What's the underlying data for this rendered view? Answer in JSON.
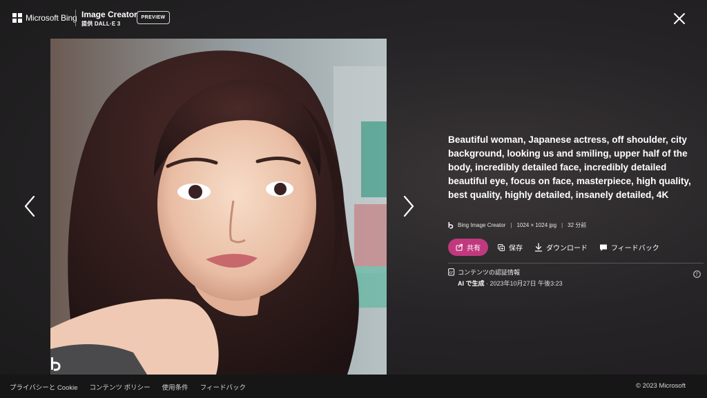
{
  "header": {
    "brand_label": "Microsoft Bing",
    "product_title": "Image Creator",
    "product_subtitle": "提供 DALL·E 3",
    "preview_badge": "PREVIEW",
    "icons": {
      "logo": "microsoft-logo-icon",
      "close": "close-icon"
    }
  },
  "image": {
    "alt": "Beautiful woman, Japanese actress, off shoulder, city background, looking us and smiling, upper half of the body, incredibly detailed face, incredibly detailed beautiful eye, focus on face, masterpiece, high quality, best quality, highly detailed, insanely detailed, 4K",
    "watermark_icon": "bing-watermark-icon"
  },
  "navigation": {
    "prev_icon": "chevron-left-icon",
    "next_icon": "chevron-right-icon"
  },
  "details": {
    "prompt": "Beautiful woman, Japanese actress, off shoulder, city background, looking us and smiling, upper half of the body, incredibly detailed face, incredibly detailed beautiful eye, focus on face, masterpiece, high quality, best quality, highly detailed, insanely detailed, 4K",
    "meta": {
      "source": "Bing Image Creator",
      "size": "1024 × 1024 jpg",
      "age": "32 分前"
    },
    "actions": {
      "share": "共有",
      "save": "保存",
      "download": "ダウンロード",
      "feedback": "フィードバック"
    },
    "credentials": {
      "title": "コンテンツの認証情報",
      "generated_label": "AI で生成",
      "generated_date": "· 2023年10月27日 午後3:23"
    }
  },
  "footer": {
    "links": [
      "プライバシーと Cookie",
      "コンテンツ ポリシー",
      "使用条件",
      "フィードバック"
    ],
    "copyright": "© 2023 Microsoft"
  },
  "colors": {
    "accent": "#c0397e",
    "background": "#262426",
    "footer": "#161616"
  }
}
